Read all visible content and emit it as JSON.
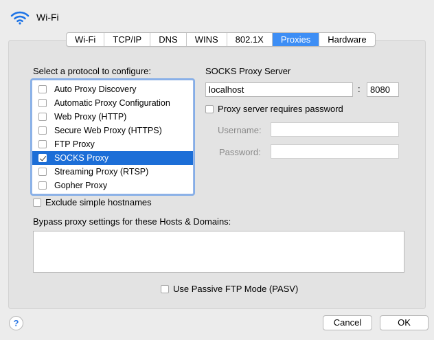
{
  "header": {
    "title": "Wi-Fi",
    "icon": "wifi-icon"
  },
  "tabs": [
    {
      "label": "Wi-Fi",
      "active": false
    },
    {
      "label": "TCP/IP",
      "active": false
    },
    {
      "label": "DNS",
      "active": false
    },
    {
      "label": "WINS",
      "active": false
    },
    {
      "label": "802.1X",
      "active": false
    },
    {
      "label": "Proxies",
      "active": true
    },
    {
      "label": "Hardware",
      "active": false
    }
  ],
  "protocols": {
    "heading": "Select a protocol to configure:",
    "items": [
      {
        "label": "Auto Proxy Discovery",
        "checked": false,
        "selected": false
      },
      {
        "label": "Automatic Proxy Configuration",
        "checked": false,
        "selected": false
      },
      {
        "label": "Web Proxy (HTTP)",
        "checked": false,
        "selected": false
      },
      {
        "label": "Secure Web Proxy (HTTPS)",
        "checked": false,
        "selected": false
      },
      {
        "label": "FTP Proxy",
        "checked": false,
        "selected": false
      },
      {
        "label": "SOCKS Proxy",
        "checked": true,
        "selected": true
      },
      {
        "label": "Streaming Proxy (RTSP)",
        "checked": false,
        "selected": false
      },
      {
        "label": "Gopher Proxy",
        "checked": false,
        "selected": false
      }
    ]
  },
  "server": {
    "heading": "SOCKS Proxy Server",
    "host": "localhost",
    "separator": ":",
    "port": "8080",
    "requires_password_label": "Proxy server requires password",
    "requires_password": false,
    "username_label": "Username:",
    "username": "",
    "password_label": "Password:",
    "password": ""
  },
  "exclude_simple_label": "Exclude simple hostnames",
  "bypass_label": "Bypass proxy settings for these Hosts & Domains:",
  "bypass_value": "",
  "passive_ftp_label": "Use Passive FTP Mode (PASV)",
  "footer": {
    "help_label": "?",
    "cancel_label": "Cancel",
    "ok_label": "OK"
  },
  "colors": {
    "accent": "#3d8ef5",
    "selection": "#1c6ed7",
    "help_glyph": "#2f7ae5"
  }
}
